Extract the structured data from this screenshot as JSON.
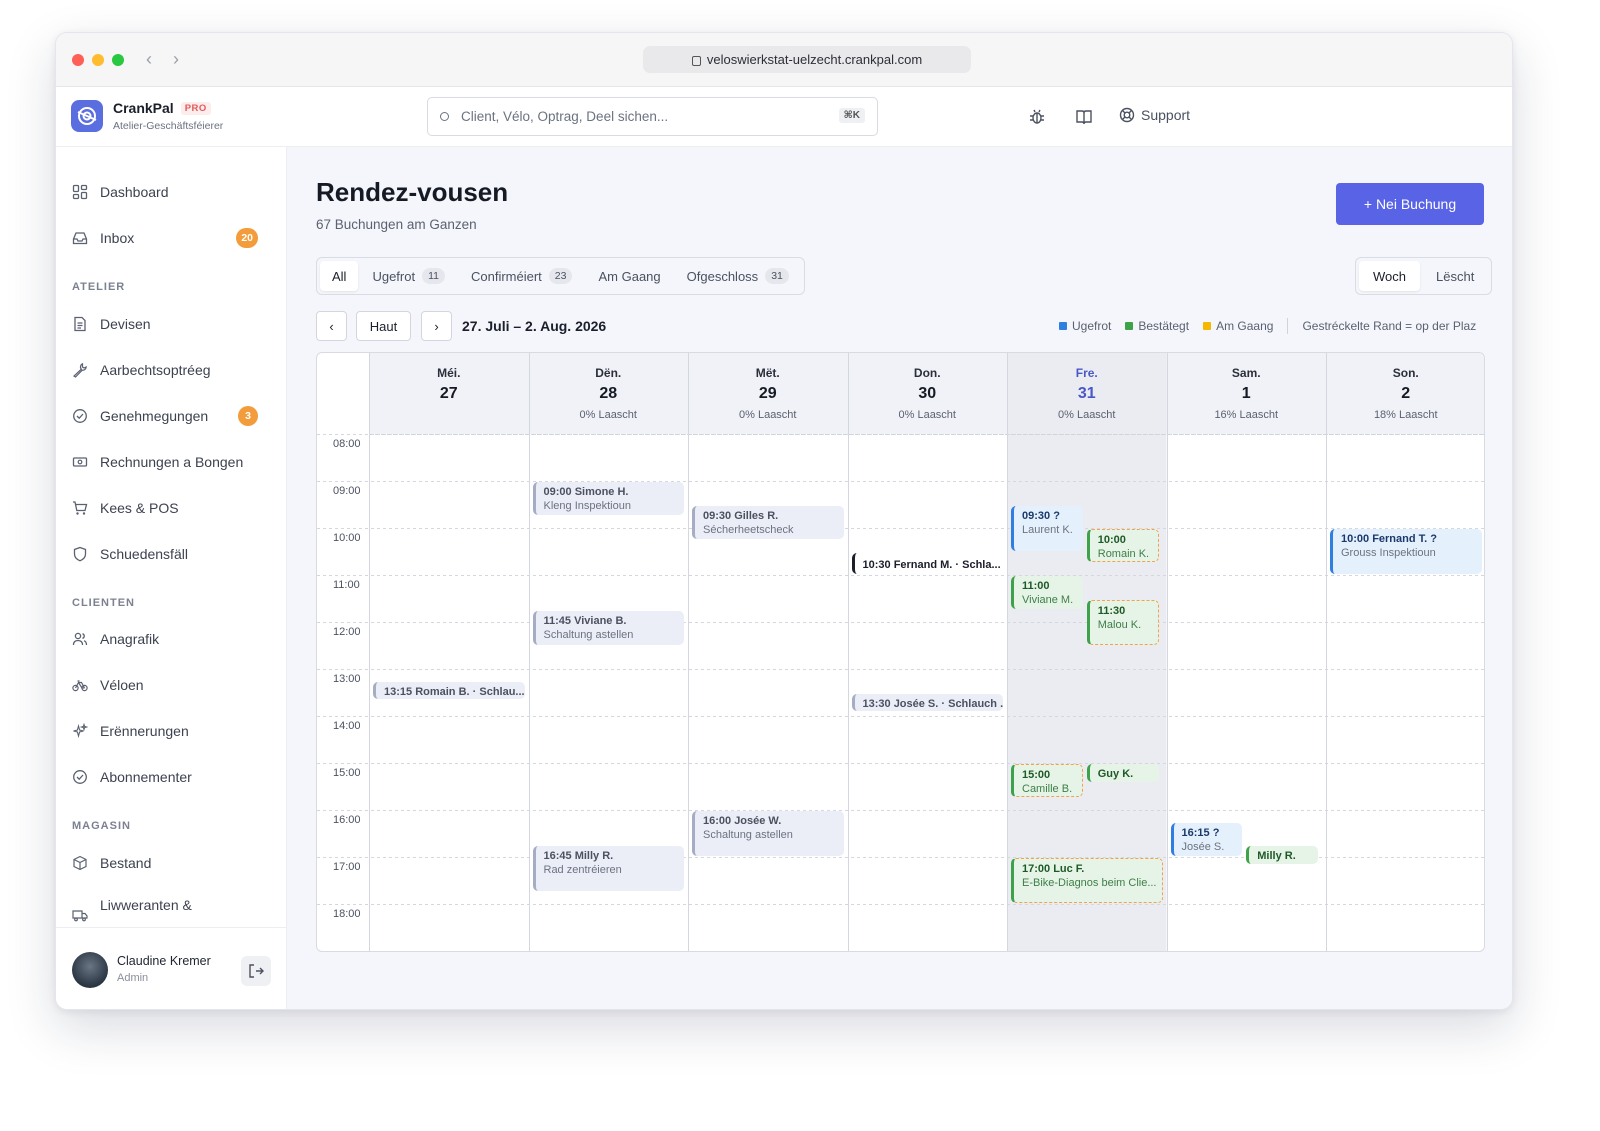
{
  "browser": {
    "url": "veloswierkstat-uelzecht.crankpal.com"
  },
  "app": {
    "name": "CrankPal",
    "tier": "PRO",
    "subtitle": "Atelier-Geschäftsféierer"
  },
  "search": {
    "placeholder": "Client, Vélo, Optrag, Deel sichen...",
    "shortcut": "⌘K"
  },
  "header": {
    "support_label": "Support",
    "icons": [
      "bug-icon",
      "book-icon",
      "lifebuoy-icon"
    ]
  },
  "sidebar": {
    "items_top": [
      {
        "label": "Dashboard",
        "icon": "grid-icon"
      },
      {
        "label": "Inbox",
        "icon": "inbox-icon",
        "badge": "20"
      }
    ],
    "sections": [
      {
        "title": "ATELIER",
        "items": [
          {
            "label": "Devisen",
            "icon": "document-icon"
          },
          {
            "label": "Aarbechtsoptréeg",
            "icon": "wrench-icon"
          },
          {
            "label": "Genehmegungen",
            "icon": "check-circle-icon",
            "badge": "3"
          },
          {
            "label": "Rechnungen a Bongen",
            "icon": "receipt-icon"
          },
          {
            "label": "Kees & POS",
            "icon": "cart-icon"
          },
          {
            "label": "Schuedensfäll",
            "icon": "shield-icon"
          }
        ]
      },
      {
        "title": "CLIENTEN",
        "items": [
          {
            "label": "Anagrafik",
            "icon": "users-icon"
          },
          {
            "label": "Véloen",
            "icon": "bike-icon"
          },
          {
            "label": "Erënnerungen",
            "icon": "sparkle-icon"
          },
          {
            "label": "Abonnementer",
            "icon": "check-circle-icon"
          }
        ]
      },
      {
        "title": "MAGASIN",
        "items": [
          {
            "label": "Bestand",
            "icon": "box-icon"
          },
          {
            "label": "Liwweranten &",
            "icon": "truck-icon"
          }
        ]
      }
    ],
    "user": {
      "name": "Claudine Kremer",
      "role": "Admin"
    }
  },
  "page": {
    "title": "Rendez-vousen",
    "subtitle": "67 Buchungen am Ganzen",
    "new_button": "+  Nei Buchung",
    "filters": [
      {
        "label": "All",
        "count": null,
        "active": true
      },
      {
        "label": "Ugefrot",
        "count": "11"
      },
      {
        "label": "Confirméiert",
        "count": "23"
      },
      {
        "label": "Am Gaang",
        "count": null
      },
      {
        "label": "Ofgeschloss",
        "count": "31"
      }
    ],
    "view_options": [
      {
        "label": "Woch",
        "active": true
      },
      {
        "label": "Lëscht"
      }
    ],
    "nav": {
      "prev": "‹",
      "today": "Haut",
      "next": "›",
      "range": "27. Juli – 2. Aug. 2026"
    },
    "legend": [
      {
        "label": "Ugefrot",
        "color": "#2f7fe0"
      },
      {
        "label": "Bestätegt",
        "color": "#3ea24a"
      },
      {
        "label": "Am Gaang",
        "color": "#f5b700"
      }
    ],
    "legend_note": "Gestréckelte Rand = op der Plaz"
  },
  "calendar": {
    "hours": [
      "08:00",
      "09:00",
      "10:00",
      "11:00",
      "12:00",
      "13:00",
      "14:00",
      "15:00",
      "16:00",
      "17:00",
      "18:00"
    ],
    "days": [
      {
        "name": "Méi.",
        "num": "27",
        "load": ""
      },
      {
        "name": "Dën.",
        "num": "28",
        "load": "0% Laascht"
      },
      {
        "name": "Mët.",
        "num": "29",
        "load": "0% Laascht"
      },
      {
        "name": "Don.",
        "num": "30",
        "load": "0% Laascht"
      },
      {
        "name": "Fre.",
        "num": "31",
        "load": "0% Laascht",
        "today": true
      },
      {
        "name": "Sam.",
        "num": "1",
        "load": "16% Laascht"
      },
      {
        "name": "Son.",
        "num": "2",
        "load": "18% Laascht"
      }
    ],
    "events": [
      {
        "day": 0,
        "start": "13:15",
        "end": "13:40",
        "lane": [
          0,
          1
        ],
        "style": "grey",
        "title": "13:15 Romain B. · Schlau...",
        "sub": ""
      },
      {
        "day": 1,
        "start": "09:00",
        "end": "09:45",
        "lane": [
          0,
          1
        ],
        "style": "grey",
        "title": "09:00 Simone H.",
        "sub": "Kleng Inspektioun"
      },
      {
        "day": 1,
        "start": "11:45",
        "end": "12:30",
        "lane": [
          0,
          1
        ],
        "style": "grey",
        "title": "11:45 Viviane B.",
        "sub": "Schaltung astellen"
      },
      {
        "day": 1,
        "start": "16:45",
        "end": "17:45",
        "lane": [
          0,
          1
        ],
        "style": "grey",
        "title": "16:45 Milly R.",
        "sub": "Rad zentréieren"
      },
      {
        "day": 2,
        "start": "09:30",
        "end": "10:15",
        "lane": [
          0,
          1
        ],
        "style": "grey",
        "title": "09:30 Gilles R.",
        "sub": "Sécherheetscheck"
      },
      {
        "day": 2,
        "start": "16:00",
        "end": "17:00",
        "lane": [
          0,
          1
        ],
        "style": "grey",
        "title": "16:00 Josée W.",
        "sub": "Schaltung astellen"
      },
      {
        "day": 3,
        "start": "10:30",
        "end": "11:00",
        "lane": [
          0,
          1
        ],
        "style": "plain",
        "title": "10:30 Fernand M. · Schla...",
        "sub": ""
      },
      {
        "day": 3,
        "start": "13:30",
        "end": "13:55",
        "lane": [
          0,
          1
        ],
        "style": "grey",
        "title": "13:30 Josée S. · Schlauch ...",
        "sub": ""
      },
      {
        "day": 4,
        "start": "09:30",
        "end": "10:30",
        "lane": [
          0,
          2
        ],
        "style": "blue",
        "title": "09:30 ?",
        "sub": "Laurent K."
      },
      {
        "day": 4,
        "start": "10:00",
        "end": "10:45",
        "lane": [
          1,
          2
        ],
        "style": "green dashed",
        "title": "10:00",
        "sub": "Romain K."
      },
      {
        "day": 4,
        "start": "11:00",
        "end": "11:45",
        "lane": [
          0,
          2
        ],
        "style": "green",
        "title": "11:00",
        "sub": "Viviane M."
      },
      {
        "day": 4,
        "start": "11:30",
        "end": "12:30",
        "lane": [
          1,
          2
        ],
        "style": "green dashed",
        "title": "11:30",
        "sub": "Malou K."
      },
      {
        "day": 4,
        "start": "15:00",
        "end": "15:45",
        "lane": [
          0,
          2
        ],
        "style": "green dashed",
        "title": "15:00",
        "sub": "Camille B."
      },
      {
        "day": 4,
        "start": "15:00",
        "end": "15:25",
        "lane": [
          1,
          2
        ],
        "style": "green",
        "title": "Guy K.",
        "sub": ""
      },
      {
        "day": 4,
        "start": "17:00",
        "end": "18:00",
        "lane": [
          0,
          1
        ],
        "style": "green dashed",
        "title": "17:00 Luc F.",
        "sub": "E-Bike-Diagnos beim Clie..."
      },
      {
        "day": 5,
        "start": "16:15",
        "end": "17:00",
        "lane": [
          0,
          2
        ],
        "style": "blue",
        "title": "16:15 ?",
        "sub": "Josée S."
      },
      {
        "day": 5,
        "start": "16:45",
        "end": "17:10",
        "lane": [
          1,
          2
        ],
        "style": "green",
        "title": "Milly R.",
        "sub": ""
      },
      {
        "day": 6,
        "start": "10:00",
        "end": "11:00",
        "lane": [
          0,
          1
        ],
        "style": "blue",
        "title": "10:00 Fernand T. ?",
        "sub": "Grouss Inspektioun"
      }
    ]
  }
}
